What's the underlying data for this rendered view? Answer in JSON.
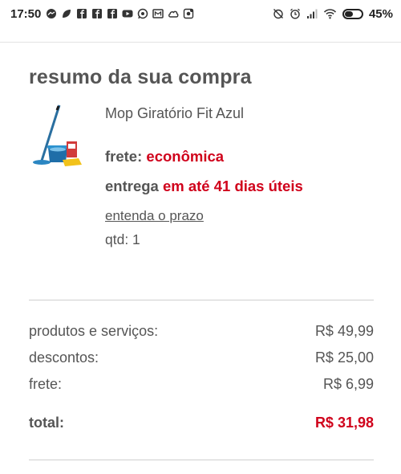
{
  "status_bar": {
    "time": "17:50",
    "battery_percent": "45%",
    "battery_level": 0.45,
    "notification_icons": [
      "messenger-icon",
      "leaf-icon",
      "facebook-icon",
      "facebook-icon",
      "facebook-icon",
      "youtube-icon",
      "whatsapp-icon",
      "mail-icon",
      "cloud-icon",
      "lock-app-icon"
    ],
    "system_icons": [
      "alarm-off-icon",
      "alarm-icon",
      "signal-icon",
      "wifi-icon",
      "battery-icon"
    ]
  },
  "summary": {
    "title": "resumo da sua compra"
  },
  "product": {
    "name": "Mop Giratório Fit Azul",
    "freight_label": "frete:",
    "freight_type": "econômica",
    "delivery_label": "entrega",
    "delivery_time": "em até 41 dias úteis",
    "deadline_link": "entenda o prazo",
    "qty_text": "qtd: 1"
  },
  "totals": {
    "products_label": "produtos e serviços:",
    "products_value": "R$ 49,99",
    "discounts_label": "descontos:",
    "discounts_value": "R$ 25,00",
    "freight_label": "frete:",
    "freight_value": "R$ 6,99",
    "total_label": "total:",
    "total_value": "R$ 31,98"
  },
  "colors": {
    "accent_red": "#d0021b",
    "text_gray": "#555555"
  }
}
